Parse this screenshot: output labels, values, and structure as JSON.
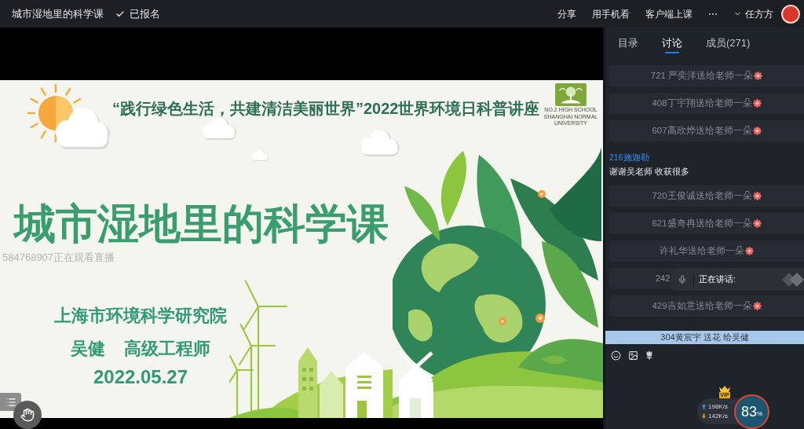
{
  "top_bar": {
    "course_title": "城市湿地里的科学课",
    "enrollment": {
      "label": "已报名",
      "enrolled": true
    },
    "actions": [
      "分享",
      "用手机看",
      "客户端上课",
      "⋯"
    ],
    "user": {
      "name": "任方方"
    }
  },
  "video": {
    "slide": {
      "series_title": "“践行绿色生活，共建清洁美丽世界”2022世界环境日科普讲座",
      "school_logo": {
        "lines": [
          "NO.2 HIGH SCHOOL",
          "SHANGHAI NORMAL UNIVERSITY"
        ]
      },
      "title": "城市湿地里的科学课",
      "institute": "上海市环境科学研究院",
      "speaker": "吴健",
      "speaker_title": "高级工程师",
      "date": "2022.05.27"
    },
    "viewer_notice": "584768907正在观看直播"
  },
  "side_panel": {
    "tabs": [
      {
        "label": "目录",
        "selected": false
      },
      {
        "label": "讨论",
        "selected": true
      },
      {
        "label": "成员(271)",
        "selected": false
      }
    ],
    "messages": [
      {
        "kind": "gift",
        "text": "721 严奕洋送给老师一朵",
        "flower": true
      },
      {
        "kind": "gift",
        "text": "408丁宇翔送给老师一朵",
        "flower": true
      },
      {
        "kind": "gift",
        "text": "607高欣烨送给老师一朵",
        "flower": true
      },
      {
        "kind": "chat",
        "sender": "216施迦勒",
        "text": "谢谢吴老师 收获很多"
      },
      {
        "kind": "gift",
        "text": "720王俊诚送给老师一朵",
        "flower": true
      },
      {
        "kind": "gift",
        "text": "621盛奇冉送给老师一朵",
        "flower": true
      },
      {
        "kind": "gift",
        "text": "许礼华送给老师一朵",
        "flower": true
      },
      {
        "kind": "covered",
        "text": "242"
      },
      {
        "kind": "gift",
        "text": "429吉如意送给老师一朵",
        "flower": true
      }
    ],
    "speaking_popup": {
      "label": "正在讲话:"
    },
    "gift_banner": "304黄宸宇 送花 给吴健",
    "network": {
      "vip_badge": "VIP",
      "upload": "198K/s",
      "download": "142K/s"
    },
    "performance": {
      "value": "83",
      "unit": "%"
    }
  }
}
